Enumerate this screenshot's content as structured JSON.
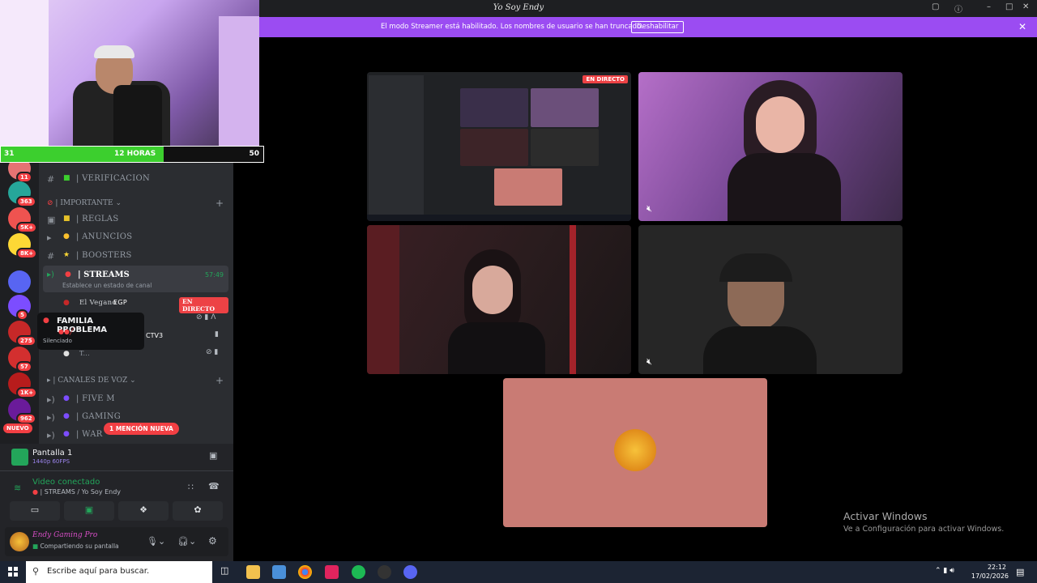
{
  "window": {
    "title": "Yo Soy Endy",
    "controls": [
      "–",
      "□",
      "✕"
    ]
  },
  "banner": {
    "message": "El modo Streamer está habilitado. Los nombres de usuario se han truncado.",
    "button": "Deshabilitar"
  },
  "overlay": {
    "left": "31",
    "center": "12 HORAS",
    "right": "50",
    "progress": 0.62
  },
  "guilds": [
    {
      "badge": "11",
      "color": "#e57373"
    },
    {
      "badge": "363",
      "color": "#26a69a"
    },
    {
      "badge": "5K+",
      "color": "#ef5350"
    },
    {
      "badge": "8K+",
      "color": "#fdd835"
    },
    {
      "badge": "",
      "color": "#5865f2"
    },
    {
      "badge": "5",
      "color": "#7c4dff"
    },
    {
      "badge": "275",
      "color": "#c62828"
    },
    {
      "badge": "57",
      "color": "#d32f2f"
    },
    {
      "badge": "1K+",
      "color": "#b71c1c"
    },
    {
      "badge": "962",
      "color": "#6a1b9a"
    }
  ],
  "guild_new_label": "NUEVO",
  "channels": {
    "verificacion": "| VERIFICACION",
    "cat_importante": "| IMPORTANTE",
    "reglas": "| REGLAS",
    "anuncios": "| ANUNCIOS",
    "boosters": "| BOOSTERS",
    "streams": "| STREAMS",
    "streams_time": "57:49",
    "streams_status": "Establece un estado de canal",
    "user1": "El Vegano",
    "user1_tag": "EGP",
    "live_label": "EN DIRECTO",
    "tooltip_title": "FAMILIA PROBLEMA",
    "tooltip_sub": "Silenciado",
    "user2_tag": "CTV3",
    "user3": "T...",
    "cat_voz": "| CANALES DE VOZ",
    "fivem": "| FIVE M",
    "gaming": "| GAMING",
    "warzone": "| WAR",
    "mention": "1 MENCIÓN NUEVA"
  },
  "panel": {
    "screen_title": "Pantalla 1",
    "screen_quality": "1440p 60FPS",
    "voice_status": "Video conectado",
    "voice_channel": "| STREAMS / Yo Soy Endy",
    "user_name": "Endy Gaming Pro",
    "user_status": "Compartiendo su pantalla"
  },
  "stage": {
    "live_badge": "EN DIRECTO",
    "activate_title": "Activar Windows",
    "activate_sub": "Ve a Configuración para activar Windows."
  },
  "taskbar": {
    "search_placeholder": "Escribe aquí para buscar.",
    "time": "22:12",
    "date": "17/02/2026"
  },
  "colors": {
    "banner": "#9b4cf2",
    "live": "#ed4245",
    "connected": "#23a55a",
    "screen_tile": "#c97b74"
  }
}
